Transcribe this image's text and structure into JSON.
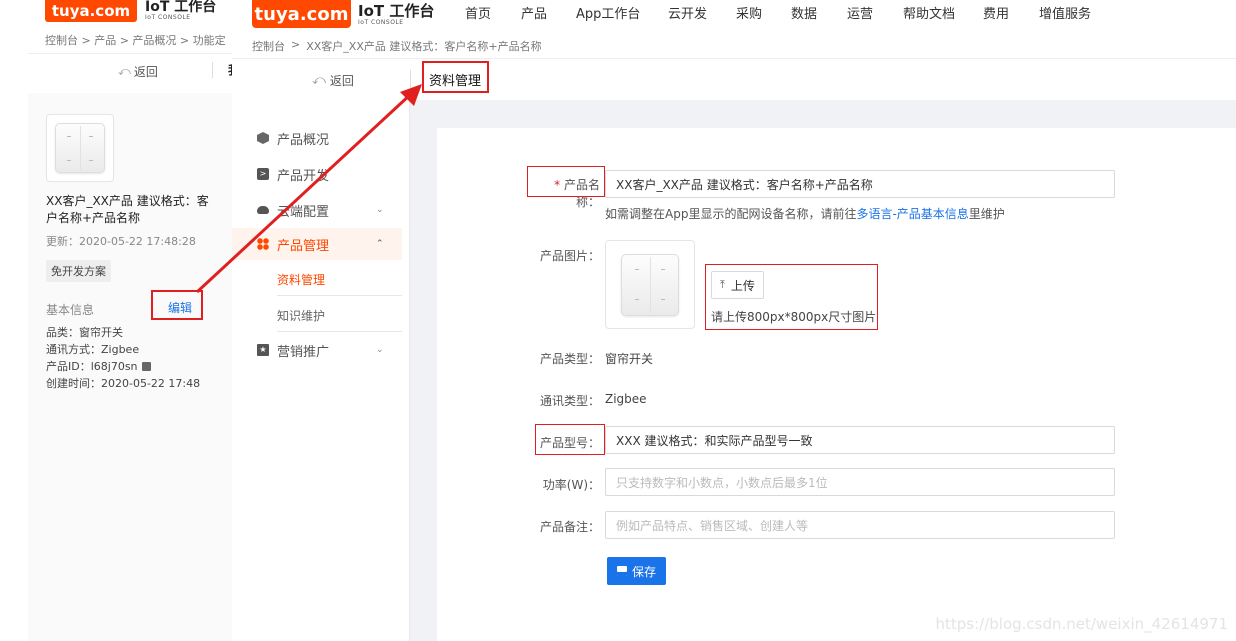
{
  "brand": {
    "logo_text": "tuya.com",
    "console_title": "IoT 工作台",
    "console_sub": "IoT CONSOLE",
    "logo_color": "#ff4800"
  },
  "background": {
    "breadcrumb": "控制台 > 产品 > 产品概况 > 功能定",
    "back_label": "返回",
    "partial_tab": "我",
    "product_name": "XX客户_XX产品 建议格式：客户名称+产品名称",
    "updated": "更新：2020-05-22 17:48:28",
    "tag": "免开发方案",
    "basic_info_label": "基本信息",
    "edit_label": "编辑",
    "info_lines": [
      "品类：窗帘开关",
      "通讯方式：Zigbee",
      "产品ID：l68j70sn",
      "创建时间：2020-05-22 17:48"
    ]
  },
  "topnav": {
    "items": [
      "首页",
      "产品",
      "App工作台",
      "云开发",
      "采购",
      "数据",
      "运营",
      "帮助文档",
      "费用",
      "增值服务"
    ]
  },
  "breadcrumb": {
    "root": "控制台",
    "sep": ">",
    "current": "XX客户_XX产品 建议格式：客户名称+产品名称"
  },
  "subheader": {
    "back_label": "返回",
    "tab_label": "资料管理"
  },
  "sidebar": {
    "items": [
      {
        "label": "产品概况",
        "icon": "cube-icon"
      },
      {
        "label": "产品开发",
        "icon": "terminal-icon"
      },
      {
        "label": "云端配置",
        "icon": "cloud-icon"
      },
      {
        "label": "产品管理",
        "icon": "grid-icon"
      },
      {
        "label": "营销推广",
        "icon": "star-icon"
      }
    ],
    "sub_items": [
      "资料管理",
      "知识维护"
    ],
    "accent": "#ff4800"
  },
  "form": {
    "name_label": "产品名称：",
    "name_required": "*",
    "name_value": "XX客户_XX产品  建议格式：客户名称+产品名称",
    "name_hint_prefix": "如需调整在App里显示的配网设备名称，请前往",
    "name_hint_link": "多语言-产品基本信息",
    "name_hint_suffix": "里维护",
    "image_label": "产品图片：",
    "upload_label": "上传",
    "upload_hint": "请上传800px*800px尺寸图片",
    "type_label": "产品类型：",
    "type_value": "窗帘开关",
    "comm_label": "通讯类型：",
    "comm_value": "Zigbee",
    "model_label": "产品型号：",
    "model_value": "XXX    建议格式：和实际产品型号一致",
    "power_label": "功率(W)：",
    "power_placeholder": "只支持数字和小数点，小数点后最多1位",
    "remark_label": "产品备注：",
    "remark_placeholder": "例如产品特点、销售区域、创建人等",
    "save_label": "保存",
    "save_color": "#1a73e8"
  },
  "watermark": "https://blog.csdn.net/weixin_42614971",
  "annotation_color": "#e02020"
}
